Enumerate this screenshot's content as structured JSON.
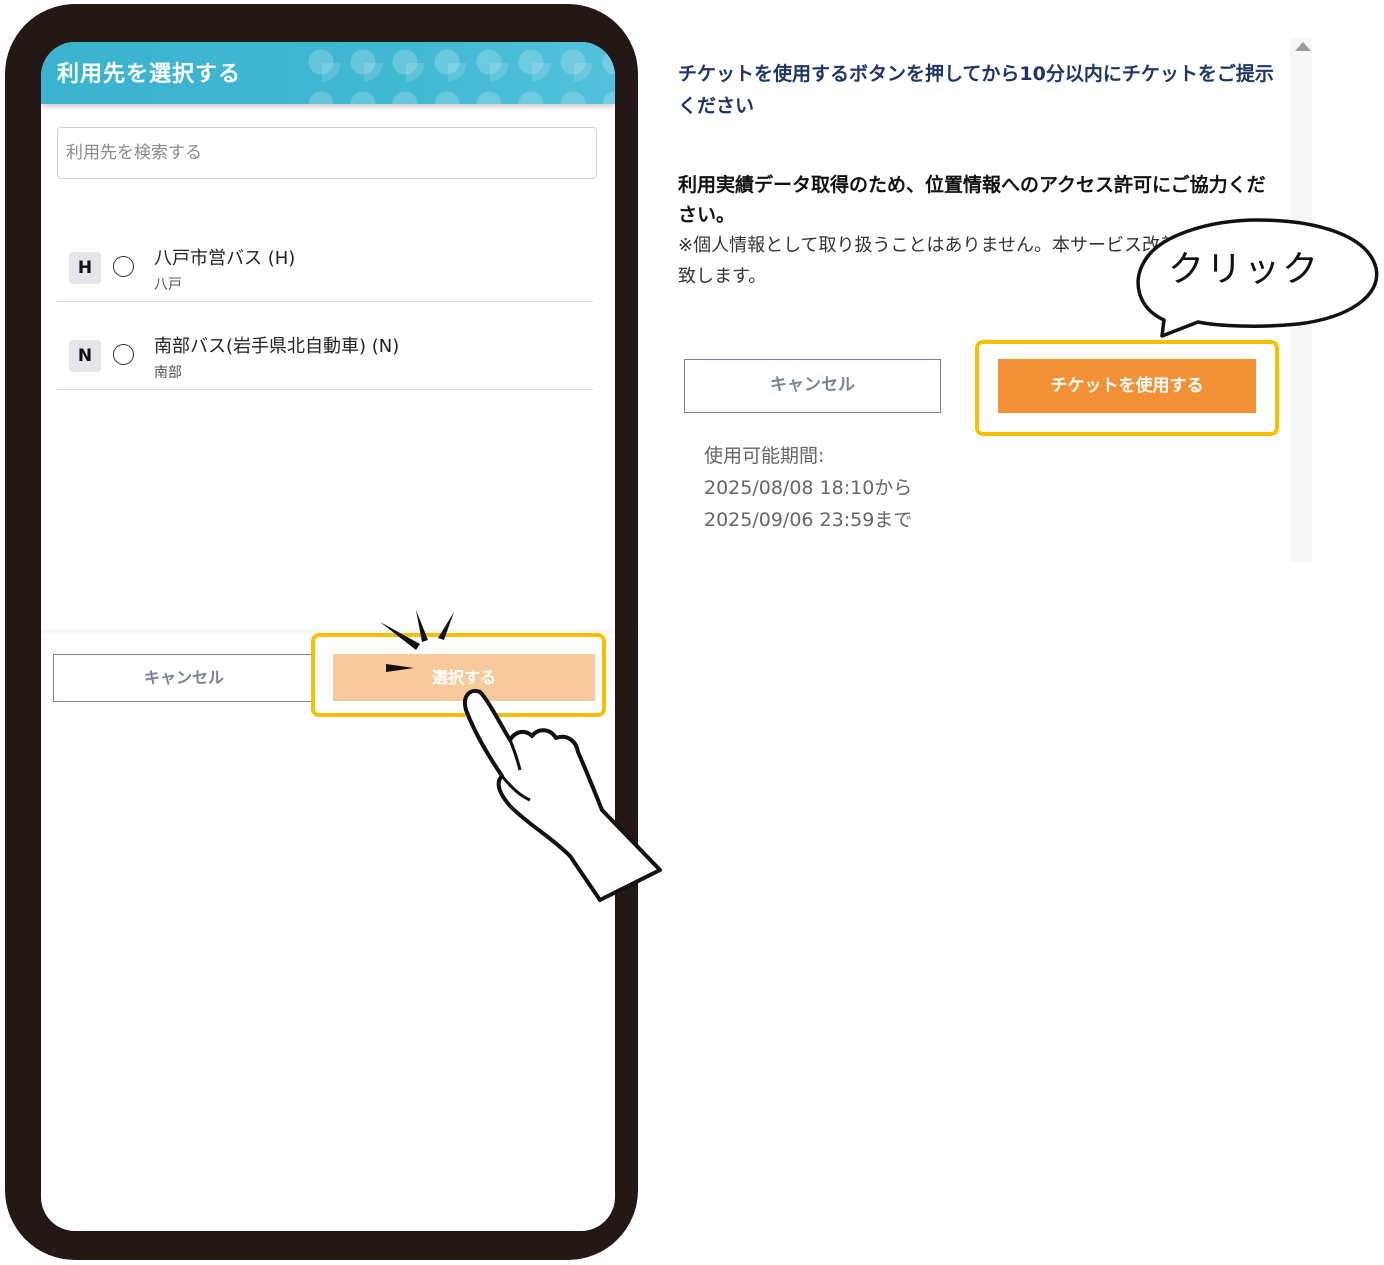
{
  "modal": {
    "title": "利用先を選択する",
    "search_placeholder": "利用先を検索する",
    "items": [
      {
        "badge": "H",
        "name": "八戸市営バス (H)",
        "sub": "八戸"
      },
      {
        "badge": "N",
        "name": "南部バス(岩手県北自動車) (N)",
        "sub": "南部"
      }
    ],
    "cancel_label": "キャンセル",
    "select_label": "選択する"
  },
  "ticket": {
    "notice": "チケットを使用するボタンを押してから10分以内にチケットをご提示ください",
    "location_request": "利用実績データ取得のため、位置情報へのアクセス許可にご協力ください。",
    "location_note": "※個人情報として取り扱うことはありません。本サービス改善のみに活用致します。",
    "cancel_label": "キャンセル",
    "use_label": "チケットを使用する",
    "period_label": "使用可能期間:",
    "period_from": "2025/08/08 18:10から",
    "period_to": "2025/09/06 23:59まで"
  },
  "annotation": {
    "bubble_text": "クリック"
  },
  "colors": {
    "header": "#40b8d2",
    "highlight": "#f5c000",
    "use_button": "#f39136",
    "select_button_disabled": "#f8c99b",
    "notice_text": "#1f3566"
  },
  "icons": [
    "radio-icon",
    "pointing-hand-icon",
    "speech-bubble-icon",
    "scroll-up-icon"
  ]
}
